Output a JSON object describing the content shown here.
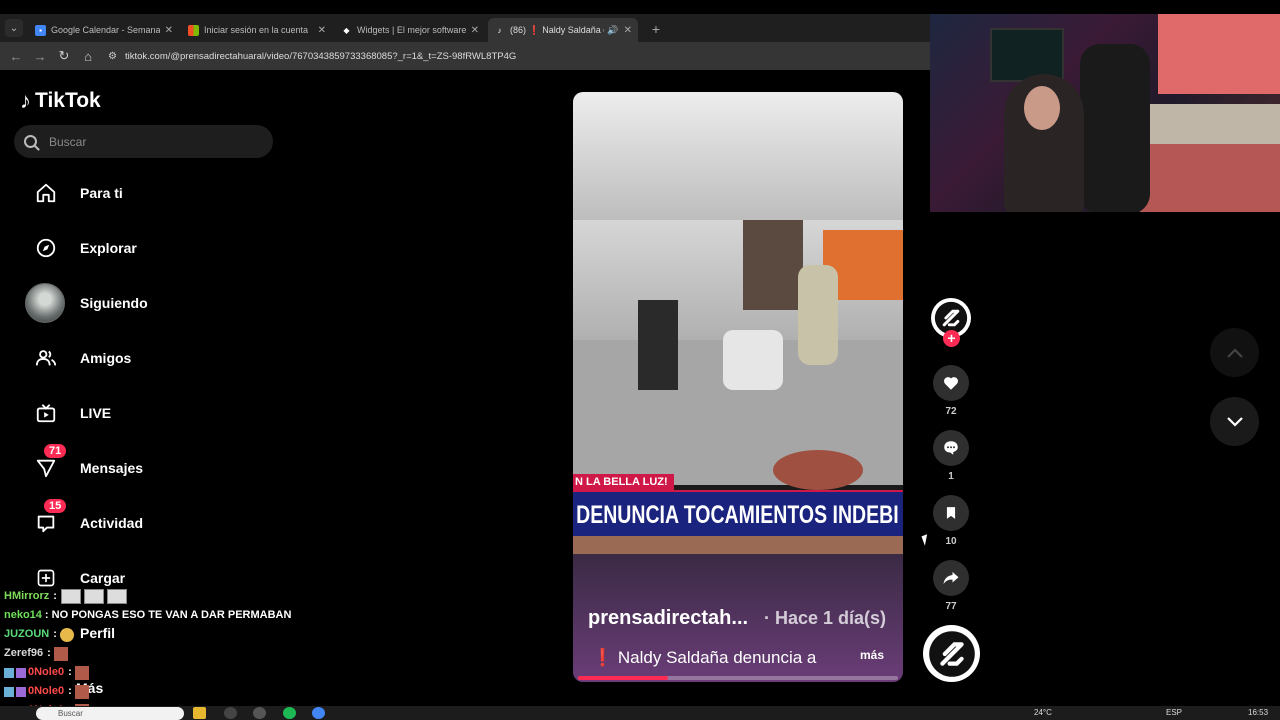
{
  "browser": {
    "tabs": [
      {
        "title": "Google Calendar - Semana del",
        "active": false
      },
      {
        "title": "Iniciar sesión en la cuenta",
        "active": false
      },
      {
        "title": "Widgets | El mejor software par",
        "active": false
      },
      {
        "title": "(86) ❗ Naldy Saldaña denun",
        "active": true
      }
    ],
    "url": "tiktok.com/@prensadirectahuaral/video/7670343859733368085?_r=1&_t=ZS-98fRWL8TP4G"
  },
  "sidebar": {
    "brand": "TikTok",
    "search_placeholder": "Buscar",
    "items": [
      {
        "label": "Para ti",
        "icon": "home-icon"
      },
      {
        "label": "Explorar",
        "icon": "compass-icon"
      },
      {
        "label": "Siguiendo",
        "icon": "following-avatar"
      },
      {
        "label": "Amigos",
        "icon": "friends-icon"
      },
      {
        "label": "LIVE",
        "icon": "live-tv-icon"
      },
      {
        "label": "Mensajes",
        "icon": "messages-icon",
        "badge": "71"
      },
      {
        "label": "Actividad",
        "icon": "inbox-icon",
        "badge": "15"
      },
      {
        "label": "Cargar",
        "icon": "upload-icon"
      },
      {
        "label": "Perfil",
        "icon": "profile-icon"
      },
      {
        "label": "Más",
        "icon": "more-icon"
      }
    ]
  },
  "video": {
    "overlay_tag": "N LA BELLA LUZ!",
    "overlay_headline": "DENUNCIA TOCAMIENTOS INDEBI",
    "author": "prensadirectah...",
    "time": "· Hace 1 día(s)",
    "description": "❗ Naldy Saldaña denuncia a",
    "more": "más",
    "progress": 0.28
  },
  "actions": {
    "likes": "72",
    "comments": "1",
    "saves": "10",
    "shares": "77"
  },
  "chat": [
    {
      "user": "HMirrorz",
      "color": "#7fdc5a",
      "text": ":",
      "emotes": 3
    },
    {
      "user": "neko14",
      "color": "#6fe05a",
      "text": ": NO PONGAS ESO TE VAN A DAR PERMABAN"
    },
    {
      "user": "JUZOUN",
      "color": "#5adc7a",
      "text": ":",
      "emotes": 1
    },
    {
      "user": "Zeref96",
      "color": "#d8d8d8",
      "text": ":",
      "emotes": 1
    },
    {
      "user": "0Nole0",
      "color": "#ff4a4a",
      "text": ":",
      "emotes": 1
    },
    {
      "user": "0Nole0",
      "color": "#ff4a4a",
      "text": ":",
      "emotes": 1
    },
    {
      "user": "0Nole0",
      "color": "#ff4a4a",
      "text": ":",
      "emotes": 1
    }
  ],
  "taskbar": {
    "search_placeholder": "Buscar",
    "weather": "24°C",
    "lang": "ESP",
    "time": "16:53"
  },
  "colors": {
    "accent": "#fe2c55",
    "background": "#000000"
  }
}
